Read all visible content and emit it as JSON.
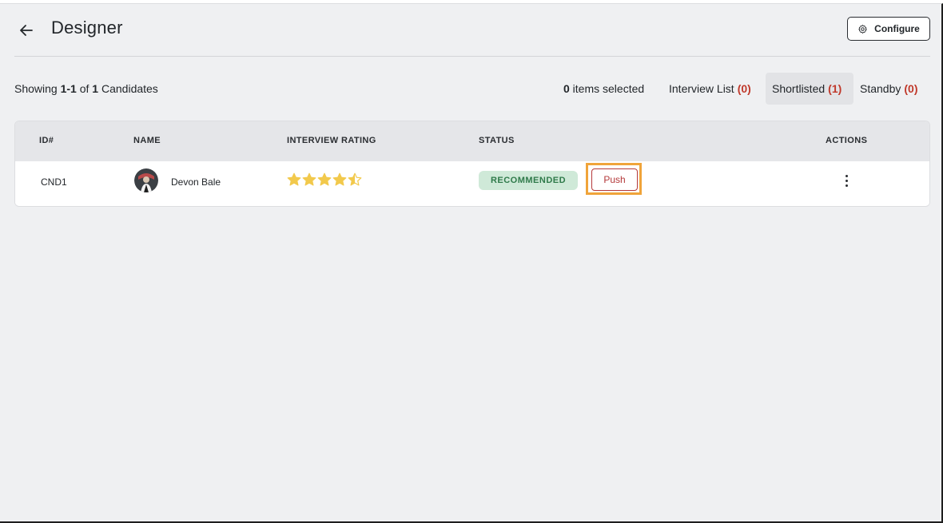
{
  "header": {
    "title": "Designer",
    "configure_label": "Configure"
  },
  "toolbar": {
    "showing_prefix": "Showing ",
    "showing_range": "1-1",
    "showing_of": " of ",
    "showing_total": "1",
    "showing_suffix": " Candidates",
    "selected_count": "0",
    "selected_label": " items selected",
    "tabs": [
      {
        "label": "Interview List",
        "count": "(0)"
      },
      {
        "label": "Shortlisted",
        "count": "(1)"
      },
      {
        "label": "Standby",
        "count": "(0)"
      }
    ]
  },
  "table": {
    "columns": [
      "ID#",
      "NAME",
      "INTERVIEW RATING",
      "STATUS",
      "ACTIONS"
    ],
    "rows": [
      {
        "id": "CND1",
        "name": "Devon Bale",
        "rating": 4.5,
        "status": "RECOMMENDED",
        "push_label": "Push"
      }
    ]
  },
  "colors": {
    "accent_red": "#c0392b",
    "status_green_bg": "#cfe9d8",
    "status_green_text": "#2f7a4a",
    "highlight_orange": "#f0a43a",
    "star_gold": "#f2c94c"
  },
  "icons": {
    "back": "arrow-left-icon",
    "configure": "gear-icon",
    "actions": "kebab-menu-icon"
  }
}
